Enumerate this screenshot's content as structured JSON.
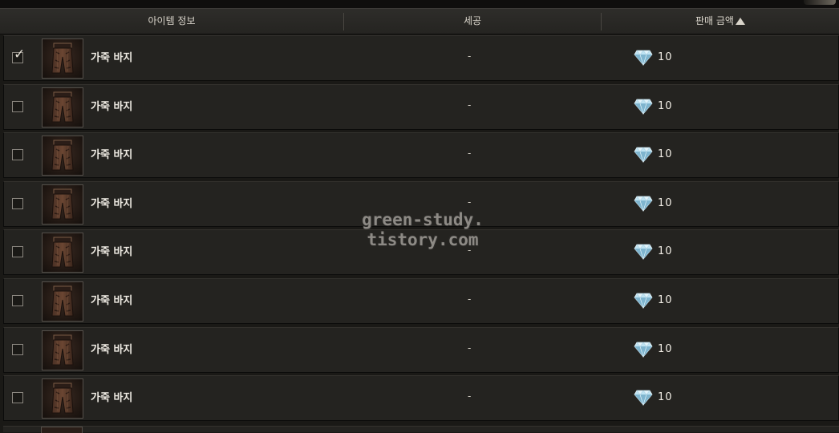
{
  "header": {
    "item_info": "아이템 정보",
    "refine": "세공",
    "sale_price": "판매 금액"
  },
  "watermark": {
    "line1": "green-study.",
    "line2": "tistory.com"
  },
  "currency_icon": "diamond-icon",
  "rows": [
    {
      "checked": true,
      "name": "가죽 바지",
      "refine": "-",
      "price": "10"
    },
    {
      "checked": false,
      "name": "가죽 바지",
      "refine": "-",
      "price": "10"
    },
    {
      "checked": false,
      "name": "가죽 바지",
      "refine": "-",
      "price": "10"
    },
    {
      "checked": false,
      "name": "가죽 바지",
      "refine": "-",
      "price": "10"
    },
    {
      "checked": false,
      "name": "가죽 바지",
      "refine": "-",
      "price": "10"
    },
    {
      "checked": false,
      "name": "가죽 바지",
      "refine": "-",
      "price": "10"
    },
    {
      "checked": false,
      "name": "가죽 바지",
      "refine": "-",
      "price": "10"
    },
    {
      "checked": false,
      "name": "가죽 바지",
      "refine": "-",
      "price": "10"
    }
  ]
}
